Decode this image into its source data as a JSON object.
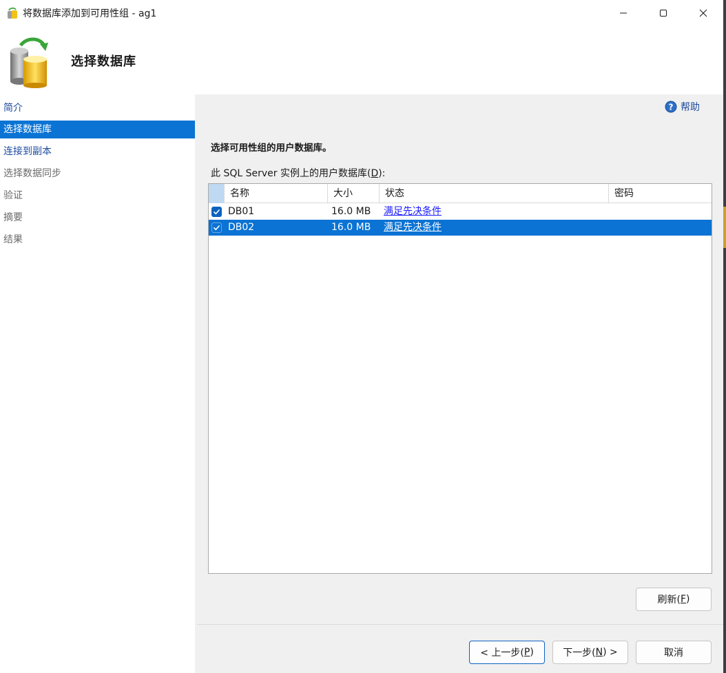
{
  "window": {
    "title": "将数据库添加到可用性组 - ag1",
    "controls": [
      "minimize",
      "maximize",
      "close"
    ]
  },
  "header": {
    "title": "选择数据库",
    "icon": "database-sync-icon"
  },
  "sidebar": {
    "items": [
      {
        "label": "简介",
        "state": "link"
      },
      {
        "label": "选择数据库",
        "state": "active"
      },
      {
        "label": "连接到副本",
        "state": "link"
      },
      {
        "label": "选择数据同步",
        "state": "disabled"
      },
      {
        "label": "验证",
        "state": "disabled"
      },
      {
        "label": "摘要",
        "state": "disabled"
      },
      {
        "label": "结果",
        "state": "disabled"
      }
    ]
  },
  "help": {
    "label": "帮助"
  },
  "main": {
    "instruction": "选择可用性组的用户数据库。",
    "list_label_prefix": "此 SQL Server 实例上的用户数据库(",
    "list_label_accel": "D",
    "list_label_suffix": "):",
    "columns": [
      "名称",
      "大小",
      "状态",
      "密码"
    ],
    "rows": [
      {
        "checked": true,
        "name": "DB01",
        "size": "16.0 MB",
        "status": "满足先决条件",
        "password": "",
        "selected": false
      },
      {
        "checked": true,
        "name": "DB02",
        "size": "16.0 MB",
        "status": "满足先决条件",
        "password": "",
        "selected": true
      }
    ]
  },
  "buttons": {
    "refresh_prefix": "刷新(",
    "refresh_accel": "F",
    "refresh_suffix": ")",
    "prev_prefix": "< 上一步(",
    "prev_accel": "P",
    "prev_suffix": ")",
    "next_prefix": "下一步(",
    "next_accel": "N",
    "next_suffix": ") >",
    "cancel": "取消"
  },
  "colors": {
    "accent": "#0b73d4",
    "link": "#1e4b9e",
    "status_link": "#1a1aff"
  }
}
